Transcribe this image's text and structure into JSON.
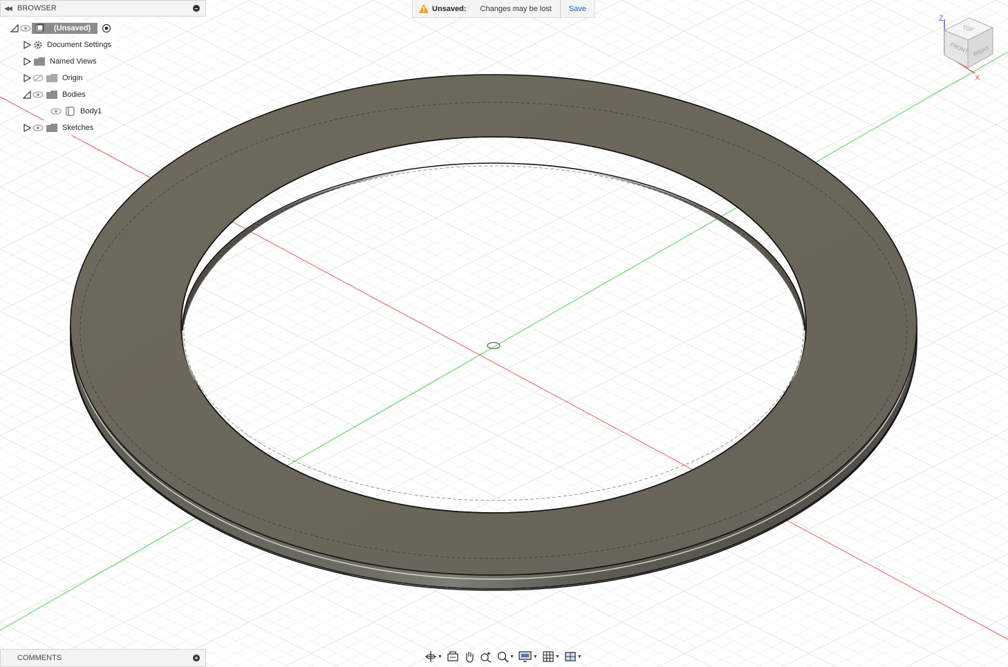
{
  "browser": {
    "title": "BROWSER",
    "root_label": "(Unsaved)",
    "items": [
      {
        "label": "Document Settings",
        "icon": "gear-icon"
      },
      {
        "label": "Named Views",
        "icon": "folder-icon"
      },
      {
        "label": "Origin",
        "icon": "folder-icon",
        "visible": false
      },
      {
        "label": "Bodies",
        "icon": "folder-icon",
        "expanded": true
      },
      {
        "label": "Body1",
        "icon": "body-icon"
      },
      {
        "label": "Sketches",
        "icon": "folder-icon"
      }
    ]
  },
  "comments": {
    "title": "COMMENTS"
  },
  "status": {
    "unsaved_label": "Unsaved:",
    "message": "Changes may be lost",
    "save_label": "Save"
  },
  "viewcube": {
    "top": "TOP",
    "front": "FRONT",
    "right": "RIGHT",
    "axis_z": "Z",
    "axis_x": "X"
  },
  "navbar": {
    "icons": [
      "orbit-icon",
      "look-at-icon",
      "pan-icon",
      "zoom-icon",
      "fit-icon",
      "display-settings-icon",
      "grid-icon",
      "viewports-icon"
    ]
  },
  "colors": {
    "body": "#6b675c",
    "x_axis": "#e03a3a",
    "y_axis": "#3cc83c",
    "z_axis": "#4a52c8",
    "accent": "#1a5fb4"
  }
}
